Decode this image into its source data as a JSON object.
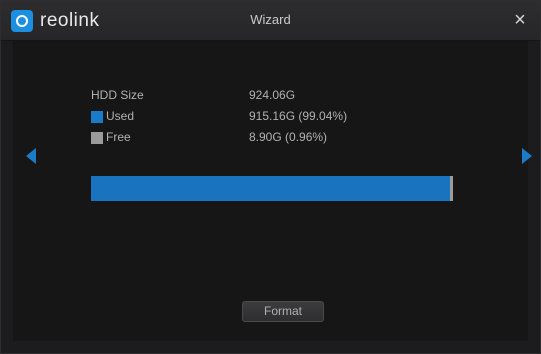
{
  "header": {
    "logo_text": "reolink",
    "title": "Wizard",
    "close_glyph": "×"
  },
  "hdd": {
    "size_label": "HDD Size",
    "size_value": "924.06G",
    "used_label": "Used",
    "used_value": "915.16G (99.04%)",
    "free_label": "Free",
    "free_value": "8.90G (0.96%)"
  },
  "usage_bar": {
    "used_percent": 99.04
  },
  "colors": {
    "accent": "#1a7cc8",
    "used": "#1a73bf",
    "free": "#9c9c9c"
  },
  "icons": {
    "logo": "reolink-logo-icon",
    "close": "close-icon",
    "prev": "arrow-left-icon",
    "next": "arrow-right-icon"
  },
  "actions": {
    "format_label": "Format"
  }
}
